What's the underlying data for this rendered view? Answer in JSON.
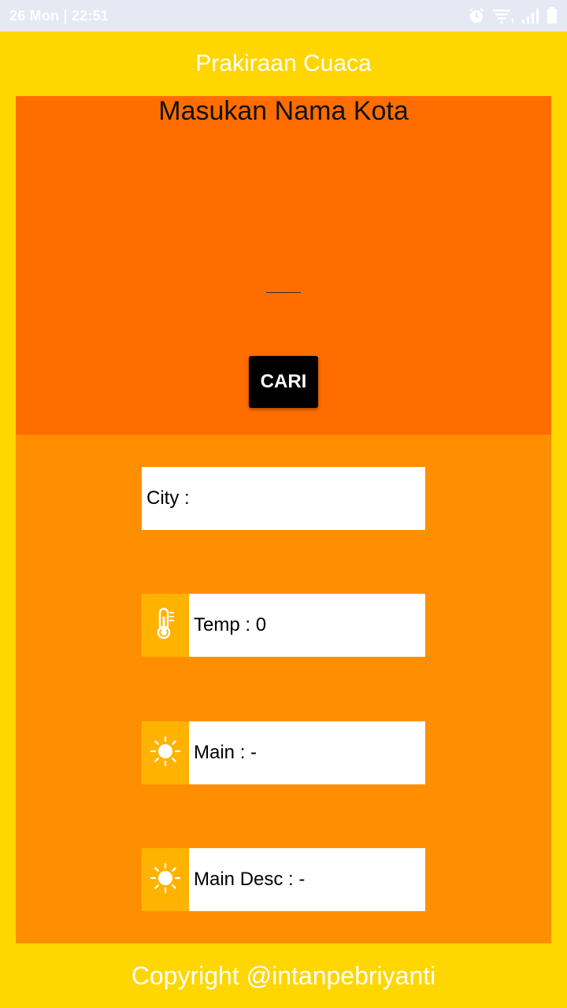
{
  "status_bar": {
    "time": "26 Mon | 22:51",
    "icons": [
      "alarm-icon",
      "wifi-icon",
      "signal-icon",
      "battery-icon"
    ]
  },
  "app_bar": {
    "title": "Prakiraan Cuaca"
  },
  "search": {
    "heading": "Masukan Nama Kota",
    "input_value": "",
    "button_label": "CARI"
  },
  "results": {
    "city": {
      "label": "City :",
      "value": ""
    },
    "temp": {
      "label": "Temp : 0",
      "icon": "thermometer-icon"
    },
    "main": {
      "label": "Main : -",
      "icon": "sun-icon"
    },
    "desc": {
      "label": "Main Desc : -",
      "icon": "sun-icon"
    }
  },
  "footer": {
    "text": "Copyright @intanpebriyanti"
  },
  "colors": {
    "background": "#FFD600",
    "search_panel": "#FF6D00",
    "result_panel": "#FF8F00",
    "icon_box": "#FFB300",
    "button": "#000000"
  }
}
